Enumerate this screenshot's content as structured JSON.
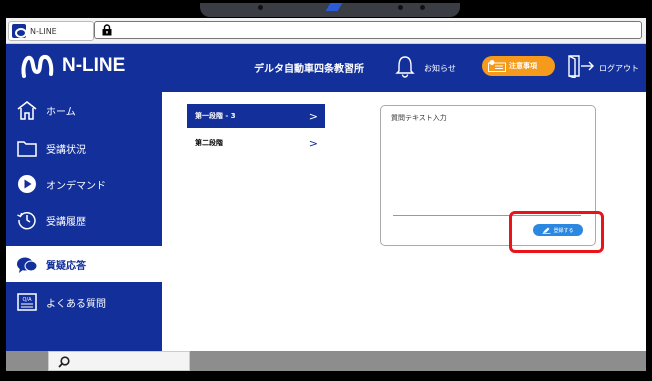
{
  "browser": {
    "tab_title": "N-LINE",
    "lock_icon": "lock-icon"
  },
  "header": {
    "logo_text": "N-LINE",
    "school_name": "デルタ自動車四条教習所",
    "notice_label": "お知らせ",
    "attention_label": "注意事項",
    "logout_label": "ログアウト",
    "colors": {
      "brand": "#13309a",
      "accent": "#f59a1b"
    }
  },
  "sidebar": {
    "items": [
      {
        "label": "ホーム",
        "icon": "home-icon",
        "active": false
      },
      {
        "label": "受講状況",
        "icon": "folder-icon",
        "active": false
      },
      {
        "label": "オンデマンド",
        "icon": "play-icon",
        "active": false
      },
      {
        "label": "受講履歴",
        "icon": "history-icon",
        "active": false
      },
      {
        "label": "質疑応答",
        "icon": "chat-icon",
        "active": true
      },
      {
        "label": "よくある質問",
        "icon": "faq-icon",
        "active": false
      }
    ],
    "faq_icon_text": "Q/A"
  },
  "main": {
    "steps": [
      {
        "label": "第一段階 - 3",
        "chevron": ">"
      },
      {
        "label": "第二段階",
        "chevron": ">"
      }
    ],
    "question_box": {
      "label": "質問テキスト入力",
      "submit_label": "登録する",
      "highlight_color": "#e8141a"
    }
  },
  "taskbar": {
    "search_icon": "search-icon"
  }
}
